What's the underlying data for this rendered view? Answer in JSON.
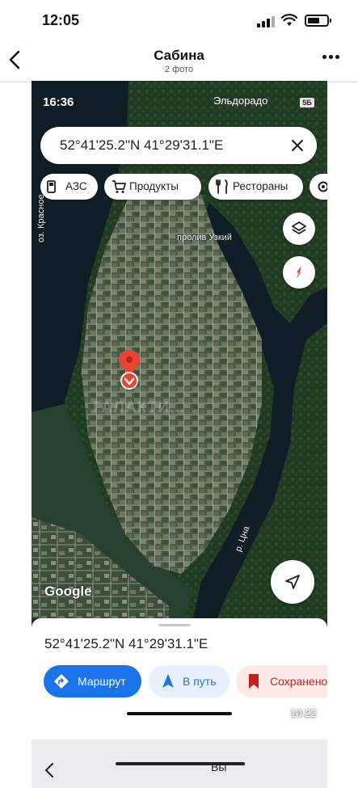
{
  "status": {
    "time": "12:05"
  },
  "nav": {
    "title": "Сабина",
    "subtitle": "2 фото"
  },
  "photo": {
    "inner_status_time": "16:36",
    "inner_status_right": "Эльдорадо",
    "inner_badge": "5Б",
    "search_text": "52°41'25.2\"N 41°29'31.1\"E",
    "chips": [
      {
        "label": "АЗС",
        "icon": "gas-station-icon"
      },
      {
        "label": "Продукты",
        "icon": "cart-icon"
      },
      {
        "label": "Рестораны",
        "icon": "restaurant-icon"
      }
    ],
    "map_labels": {
      "lake": "оз. Красное",
      "channel": "пролив Узкий",
      "river": "р. Цна"
    },
    "watermark": "ГАЛАКТИ...",
    "google_logo": "Google",
    "sheet": {
      "coords": "52°41'25.2\"N 41°29'31.1\"E",
      "route_label": "Маршрут",
      "go_label": "В путь",
      "save_label": "Сохранено",
      "time": "10:22"
    }
  },
  "photo2": {
    "partial_text": "Вы"
  },
  "colors": {
    "accent": "#1a73e8",
    "pin": "#ea4335",
    "river": "#0f1e26"
  }
}
